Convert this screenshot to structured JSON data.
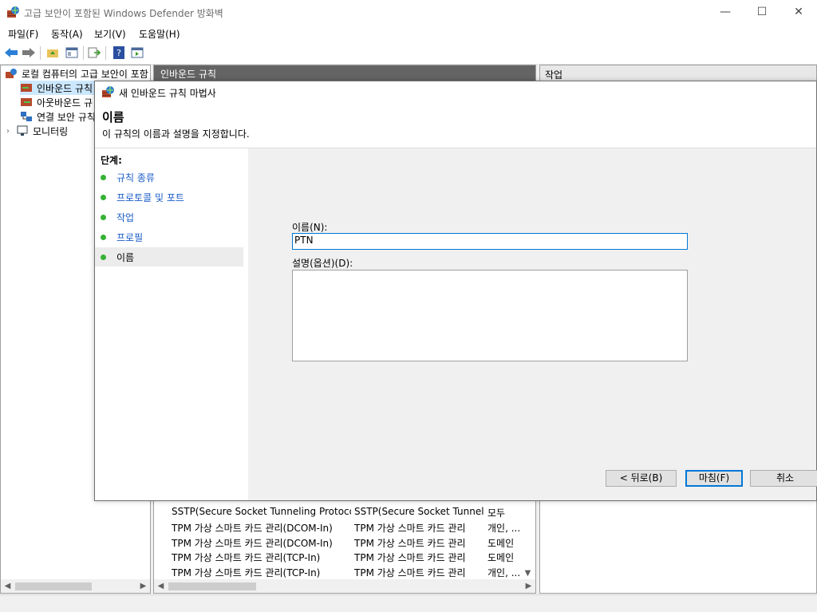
{
  "window": {
    "title": "고급 보안이 포함된 Windows Defender 방화벽",
    "minimize": "—",
    "maximize": "☐",
    "close": "✕"
  },
  "menu": [
    "파일(F)",
    "동작(A)",
    "보기(V)",
    "도움말(H)"
  ],
  "tree": {
    "header": "로컬 컴퓨터의 고급 보안이 포함",
    "items": [
      "인바운드 규칙",
      "아웃바운드 규",
      "연결 보안 규칙",
      "모니터링"
    ]
  },
  "middle": {
    "header": "인바운드 규칙",
    "rows": [
      {
        "name": "SSTP(Secure Socket Tunneling Protocol)...",
        "group": "SSTP(Secure Socket Tunnel...",
        "profile": "모두"
      },
      {
        "name": "TPM 가상 스마트 카드 관리(DCOM-In)",
        "group": "TPM 가상 스마트 카드 관리",
        "profile": "개인, ..."
      },
      {
        "name": "TPM 가상 스마트 카드 관리(DCOM-In)",
        "group": "TPM 가상 스마트 카드 관리",
        "profile": "도메인"
      },
      {
        "name": "TPM 가상 스마트 카드 관리(TCP-In)",
        "group": "TPM 가상 스마트 카드 관리",
        "profile": "도메인"
      },
      {
        "name": "TPM 가상 스마트 카드 관리(TCP-In)",
        "group": "TPM 가상 스마트 카드 관리",
        "profile": "개인, ..."
      }
    ]
  },
  "right": {
    "header": "작업"
  },
  "wizard": {
    "title": "새 인바운드 규칙 마법사",
    "heading": "이름",
    "subheading": "이 규칙의 이름과 설명을 지정합니다.",
    "steps_title": "단계:",
    "steps": [
      "규칙 종류",
      "프로토콜 및 포트",
      "작업",
      "프로필",
      "이름"
    ],
    "name_label": "이름(N):",
    "name_value": "PTN",
    "description_label": "설명(옵션)(D):",
    "description_value": "",
    "back_button": "< 뒤로(B)",
    "finish_button": "마침(F)",
    "cancel_button": "취소"
  }
}
